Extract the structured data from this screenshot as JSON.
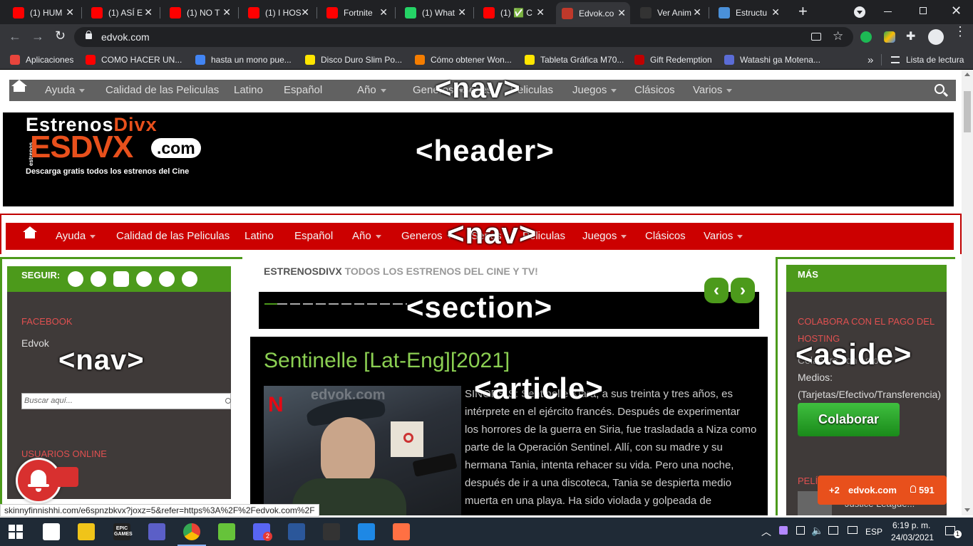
{
  "browser": {
    "tabs": [
      {
        "title": "(1) HUM",
        "favicon": "youtube-icon",
        "color": "#ff0000"
      },
      {
        "title": "(1) ASÍ E",
        "favicon": "youtube-icon",
        "color": "#ff0000"
      },
      {
        "title": "(1) NO T",
        "favicon": "youtube-icon",
        "color": "#ff0000"
      },
      {
        "title": "(1) I HOS",
        "favicon": "youtube-icon",
        "color": "#ff0000"
      },
      {
        "title": "Fortnite",
        "favicon": "youtube-icon",
        "color": "#ff0000"
      },
      {
        "title": "(1) What",
        "favicon": "whatsapp-icon",
        "color": "#25d366"
      },
      {
        "title": "(1) ✅ C",
        "favicon": "youtube-icon",
        "color": "#ff0000"
      },
      {
        "title": "Edvok.co",
        "favicon": "edvok-icon",
        "color": "#c0392b",
        "active": true
      },
      {
        "title": "Ver Anim",
        "favicon": "animeflv-icon",
        "color": "#333333"
      },
      {
        "title": "Estructu",
        "favicon": "globe-icon",
        "color": "#4a90d9"
      }
    ],
    "new_tab": "+",
    "url": "edvok.com",
    "bookmarks": [
      {
        "label": "Aplicaciones",
        "icon": "apps-grid-icon",
        "color": "#e8453c"
      },
      {
        "label": "COMO HACER UN...",
        "icon": "youtube-icon",
        "color": "#ff0000"
      },
      {
        "label": "hasta un mono pue...",
        "icon": "google-icon",
        "color": "#4285f4"
      },
      {
        "label": "Disco Duro Slim Po...",
        "icon": "mercadolibre-icon",
        "color": "#ffe600"
      },
      {
        "label": "Cómo obtener Won...",
        "icon": "blogger-icon",
        "color": "#f57d00"
      },
      {
        "label": "Tableta Gráfica M70...",
        "icon": "mercadolibre-icon",
        "color": "#ffe600"
      },
      {
        "label": "Gift Redemption",
        "icon": "steam-icon",
        "color": "#c00000"
      },
      {
        "label": "Watashi ga Motena...",
        "icon": "site-icon",
        "color": "#5b6cd6"
      }
    ],
    "bookmarks_overflow": "»",
    "reading_list": "Lista de lectura"
  },
  "page": {
    "top_nav": {
      "items": [
        "Ayuda",
        "Calidad de las Peliculas",
        "Latino",
        "Español",
        "Año",
        "Generos",
        "Series",
        "Peliculas",
        "Juegos",
        "Clásicos",
        "Varios"
      ],
      "dropdown": [
        true,
        false,
        false,
        false,
        true,
        true,
        false,
        false,
        true,
        false,
        true
      ],
      "overlay_tag": "<nav>"
    },
    "header": {
      "logo_line1_a": "Estrenos",
      "logo_line1_b": "Divx",
      "logo_line2": "ESDVX",
      "logo_com": ".com",
      "logo_small": "estrenos",
      "logo_tagline": "Descarga gratis todos los estrenos del Cine",
      "overlay_tag": "<header>"
    },
    "red_nav": {
      "items": [
        "Ayuda",
        "Calidad de las Peliculas",
        "Latino",
        "Español",
        "Año",
        "Generos",
        "Series",
        "Peliculas",
        "Juegos",
        "Clásicos",
        "Varios"
      ],
      "dropdown": [
        true,
        false,
        false,
        false,
        true,
        true,
        false,
        false,
        true,
        false,
        true
      ],
      "overlay_tag": "<nav>"
    },
    "left_sidebar": {
      "follow_label": "SEGUIR:",
      "social_icons": [
        "facebook-icon",
        "twitter-icon",
        "youtube-icon",
        "rss-icon",
        "google-plus-icon",
        "instagram-icon"
      ],
      "facebook_title": "FACEBOOK",
      "facebook_name": "Edvok",
      "search_placeholder": "Buscar aquí...",
      "users_online_title": "USUARIOS ONLINE",
      "overlay_tag": "<nav>"
    },
    "main": {
      "breadcrumb_brand": "ESTRENOSDIVX",
      "breadcrumb_text": "TODOS LOS ESTRENOS DEL CINE Y TV!",
      "section_tag": "<section>",
      "article_title": "Sentinelle [Lat-Eng][2021]",
      "article_tag": "<article>",
      "watermark": "edvok.com",
      "netflix_letter": "N",
      "synopsis_lines": [
        "SINOPSIS: Sentinelle Klara, a sus treinta y tres años, es",
        "intérprete en el ejército francés. Después de experimentar",
        "los horrores de la guerra en Siria, fue trasladada a Niza como",
        "parte de la Operación Sentinel. Allí, con su madre y su",
        "hermana Tania, intenta rehacer su vida. Pero una noche,",
        "después de ir a una discoteca, Tania se despierta medio",
        "muerta en una playa. Ha sido violada y golpeada de"
      ]
    },
    "right_sidebar": {
      "title": "MÁS",
      "donate_title_1": "COLABORA CON EL PAGO DEL",
      "donate_title_2": "HOSTING",
      "donate_line": "Colabora con estos",
      "donate_methods_1": "Medios:",
      "donate_methods_2": "(Tarjetas/Efectivo/Transferencia)",
      "donate_button": "Colaborar",
      "next_title": "PELÍ",
      "next_item": "Justice League...",
      "overlay_tag": "<aside>"
    },
    "popup": {
      "plus": "+2",
      "site": "edvok.com",
      "users": "591"
    }
  },
  "status_url": "skinnyfinnishhi.com/e6spnzbkvx?joxz=5&refer=https%3A%2F%2Fedvok.com%2F",
  "taskbar": {
    "apps": [
      "windows-start-icon",
      "task-view-icon",
      "file-explorer-icon",
      "epic-games-icon",
      "teams-icon",
      "chrome-icon",
      "bluestacks-icon",
      "discord-icon",
      "word-icon",
      "terminal-icon",
      "photos-icon",
      "paint-icon"
    ],
    "epic_label": "EPIC GAMES",
    "lang": "ESP",
    "time": "6:19 p. m.",
    "date": "24/03/2021",
    "notifications": "1",
    "discord_badge": "2"
  }
}
